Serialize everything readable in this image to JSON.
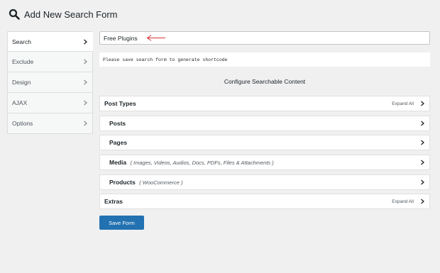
{
  "page": {
    "title": "Add New Search Form"
  },
  "sidebar": {
    "items": [
      {
        "label": "Search",
        "active": true
      },
      {
        "label": "Exclude",
        "active": false
      },
      {
        "label": "Design",
        "active": false
      },
      {
        "label": "AJAX",
        "active": false
      },
      {
        "label": "Options",
        "active": false
      }
    ]
  },
  "form": {
    "name_value": "Free Plugins",
    "notice": "Please save search form to generate shortcode",
    "section_heading": "Configure Searchable Content",
    "panels": [
      {
        "title": "Post Types",
        "action": "Expand All"
      },
      {
        "title": "Posts"
      },
      {
        "title": "Pages"
      },
      {
        "title": "Media",
        "note": "( Images, Videos, Audios, Docs, PDFs, Files & Attachments )"
      },
      {
        "title": "Products",
        "note": "( WooCommerce )"
      },
      {
        "title": "Extras",
        "action": "Expand All"
      }
    ],
    "save_label": "Save Form"
  },
  "colors": {
    "accent": "#2271b1",
    "annotation_arrow": "#d63638"
  },
  "icons": {
    "title": "search-icon",
    "chevron": "chevron-right-icon",
    "annotation": "arrow-left-icon"
  }
}
